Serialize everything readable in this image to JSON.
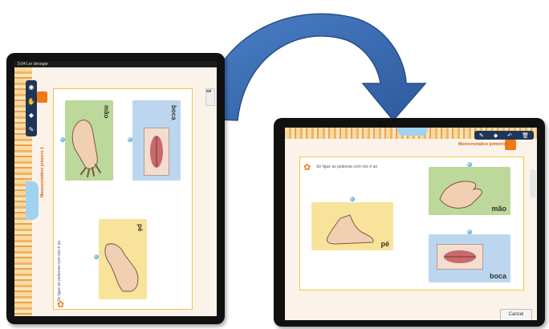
{
  "left_tablet": {
    "status_text": "5:04   Ler devagar",
    "toolbar_icons": [
      "eye-icon",
      "hand-icon",
      "eraser-icon",
      "pencil-icon"
    ],
    "section_title": "Monocromático primeiro 1",
    "instruction": "Se ligue as palavras com voc ê ao",
    "cards": [
      {
        "label": "mão",
        "color": "#bcd89b"
      },
      {
        "label": "boca",
        "color": "#bcd6ef"
      },
      {
        "label": "pé",
        "color": "#f8e39a"
      }
    ],
    "side_label": "sel"
  },
  "right_tablet": {
    "toolbar_icons": [
      "pencil-icon",
      "eraser-icon",
      "undo-icon",
      "trash-icon"
    ],
    "section_title": "Monocromático primeiro 1",
    "instruction": "Se ligue as palavras com voc ê ao",
    "cards": [
      {
        "label": "pé",
        "color": "#f8e39a"
      },
      {
        "label": "mão",
        "color": "#bcd89b"
      },
      {
        "label": "boca",
        "color": "#bcd6ef"
      }
    ],
    "cancel_label": "Cancel"
  },
  "colors": {
    "toolbar": "#1f3657",
    "accent_orange": "#ef7a16",
    "border_yellow": "#f2c545",
    "arrow_blue": "#3c6db5"
  }
}
